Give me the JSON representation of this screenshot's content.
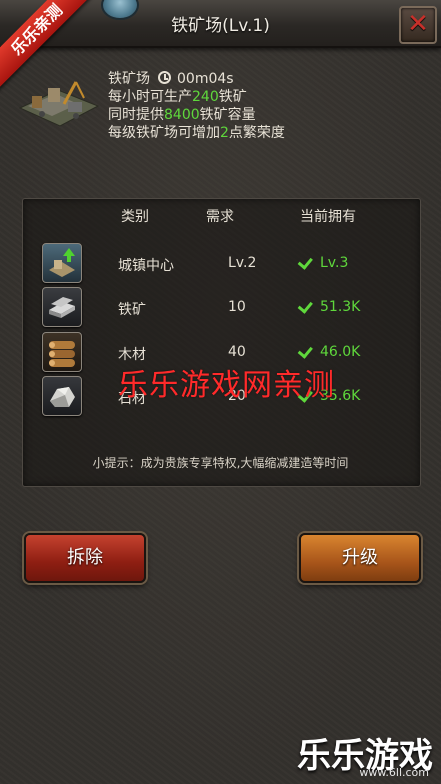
{
  "header": {
    "title": "铁矿场(Lv.1)",
    "ribbon": "乐乐亲测"
  },
  "info": {
    "name": "铁矿场",
    "timer": "00m04s",
    "line1_a": "每小时可生产",
    "line1_num": "240",
    "line1_b": "铁矿",
    "line2_a": "同时提供",
    "line2_num": "8400",
    "line2_b": "铁矿容量",
    "line3_a": "每级铁矿场可增加",
    "line3_num": "2",
    "line3_b": "点繁荣度"
  },
  "table": {
    "headers": [
      "类别",
      "需求",
      "当前拥有"
    ],
    "rows": [
      {
        "icon": "town-center-icon",
        "name": "城镇中心",
        "need": "Lv.2",
        "have": "Lv.3"
      },
      {
        "icon": "iron-ore-icon",
        "name": "铁矿",
        "need": "10",
        "have": "51.3K"
      },
      {
        "icon": "wood-icon",
        "name": "木材",
        "need": "40",
        "have": "46.0K"
      },
      {
        "icon": "stone-icon",
        "name": "石材",
        "need": "20",
        "have": "35.6K"
      }
    ],
    "tip": "小提示：成为贵族专享特权,大幅缩减建造等时间"
  },
  "buttons": {
    "demolish": "拆除",
    "upgrade": "升级"
  },
  "watermark": "乐乐游戏网亲测",
  "brand": {
    "name": "乐乐游戏",
    "url": "www.6ll.com"
  },
  "colors": {
    "highlight": "#5fd83c",
    "close": "#c8302a",
    "ribbon": "#e23b2c"
  }
}
